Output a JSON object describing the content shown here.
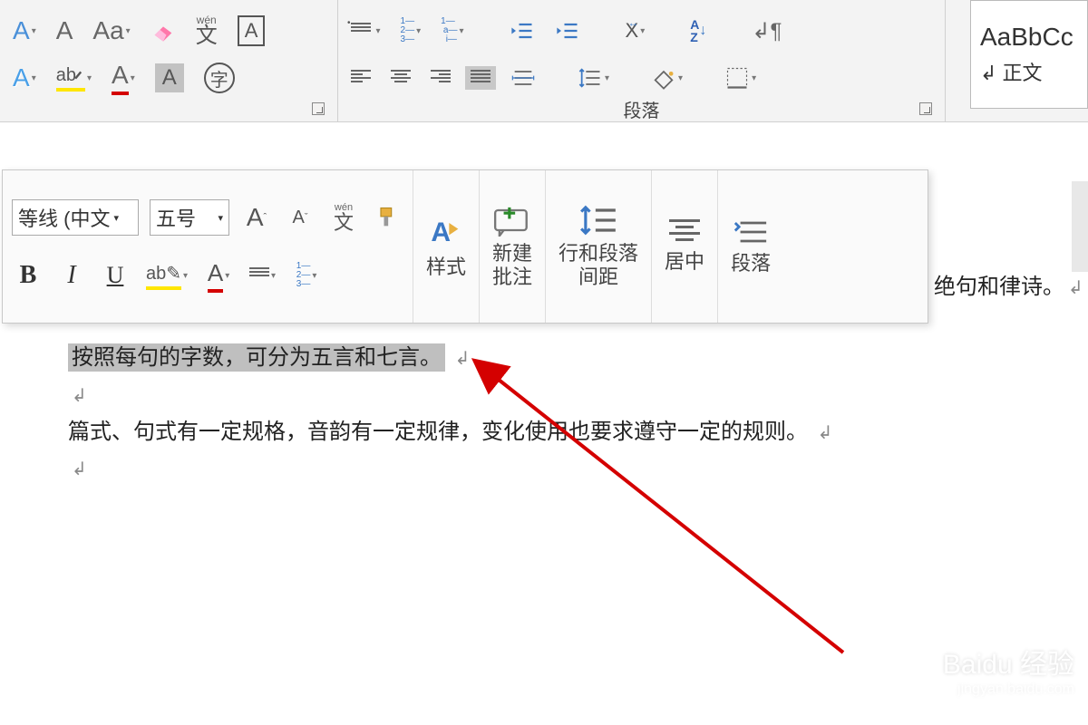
{
  "ribbon": {
    "font_group": {
      "clear_A": "A",
      "change_case": "Aa",
      "wen_top": "wén",
      "wen_char": "文",
      "char_A_box": "A",
      "highlight": "ab",
      "font_color_A": "A",
      "shade_A": "A",
      "char_border": "字"
    },
    "paragraph_group": {
      "label": "段落"
    },
    "styles": {
      "preview": "AaBbCc",
      "name": "正文"
    }
  },
  "mini": {
    "font_name": "等线 (中文",
    "font_size": "五号",
    "grow_A": "A",
    "shrink_A": "A",
    "wen_top": "wén",
    "wen_char": "文",
    "bold": "B",
    "italic": "I",
    "underline": "U",
    "highlight": "ab",
    "font_color_A": "A",
    "styles_label": "样式",
    "new_comment_l1": "新建",
    "new_comment_l2": "批注",
    "line_spacing_l1": "行和段落",
    "line_spacing_l2": "间距",
    "center": "居中",
    "paragraph": "段落"
  },
  "doc": {
    "partial_right": "绝句和律诗。",
    "selected": "按照每句的字数，可分为五言和七言。",
    "line3": "篇式、句式有一定规格，音韵有一定规律，变化使用也要求遵守一定的规则。"
  },
  "watermark": {
    "main": "Baidu 经验",
    "sub": "jingyan.baidu.com"
  }
}
